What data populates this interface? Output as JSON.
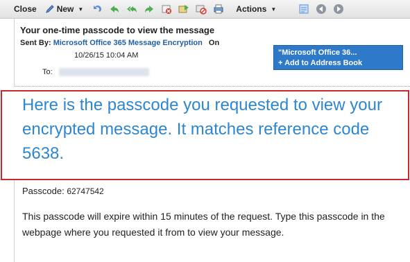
{
  "toolbar": {
    "close_label": "Close",
    "new_label": "New",
    "actions_label": "Actions",
    "icons": [
      "undo-icon",
      "reply-icon",
      "reply-all-icon",
      "forward-icon",
      "delete-icon",
      "move-icon",
      "block-icon",
      "print-icon",
      "list-icon",
      "prev-icon",
      "next-icon"
    ]
  },
  "message": {
    "subject": "Your one-time passcode to view the message",
    "sent_by_label": "Sent By:",
    "sender": "Microsoft Office 365 Message Encryption",
    "on_label": "On",
    "date": "10/26/15 10:04 AM",
    "to_label": "To:"
  },
  "popup": {
    "name": "\"Microsoft Office 36...",
    "add_label": "+ Add to Address Book"
  },
  "body": {
    "headline": "Here is the passcode you requested to view your encrypted message. It matches reference code 5638.",
    "passcode_label": "Passcode:",
    "passcode_value": "62747542",
    "paragraph": "This passcode will expire within 15 minutes of the request. Type this passcode in the webpage where you requested it from to view your message."
  },
  "colors": {
    "highlight_border": "#c8272e",
    "headline_text": "#2e86d0",
    "sender_link": "#1f5fa8",
    "popup_bg": "#2f79c9"
  }
}
